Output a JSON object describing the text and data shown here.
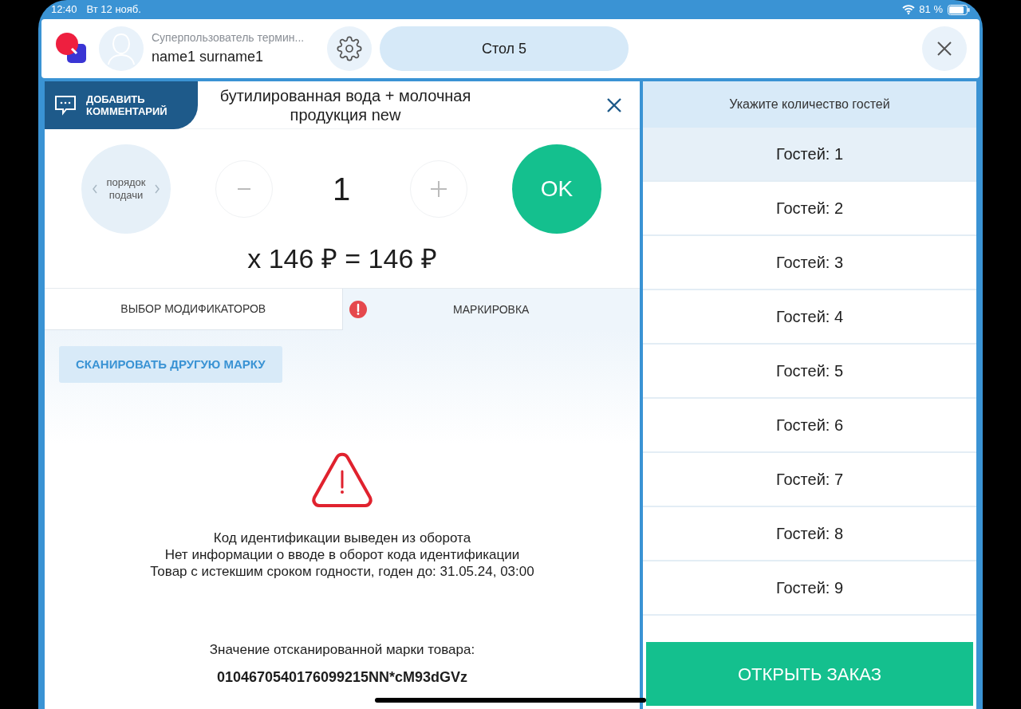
{
  "status_bar": {
    "time": "12:40",
    "date": "Вт 12 нояб.",
    "battery": "81 %"
  },
  "header": {
    "user_role": "Суперпользователь термин...",
    "user_name": "name1 surname1",
    "table": "Стол 5"
  },
  "item": {
    "comment_button": "ДОБАВИТЬ КОММЕНТАРИЙ",
    "title": "бутилированная вода + молочная продукция new",
    "course": "порядок подачи",
    "quantity": "1",
    "ok": "OK",
    "price": "x 146 ₽ = 146 ₽"
  },
  "tabs": [
    {
      "label": "ВЫБОР МОДИФИКАТОРОВ",
      "selected": false,
      "alert": false
    },
    {
      "label": "МАРКИРОВКА",
      "selected": true,
      "alert": true
    }
  ],
  "marking": {
    "scan_button": "СКАНИРОВАТЬ ДРУГУЮ МАРКУ",
    "errors": [
      "Код идентификации выведен из оборота",
      "Нет информации о вводе в оборот кода идентификации",
      "Товар с истекшим сроком годности, годен до: 31.05.24, 03:00"
    ],
    "scanned_label": "Значение отсканированной марки товара:",
    "scanned_value": "0104670540176099215NN*cM93dGVz"
  },
  "guests": {
    "title": "Укажите количество гостей",
    "options": [
      {
        "label": "Гостей: 1",
        "selected": true
      },
      {
        "label": "Гостей: 2",
        "selected": false
      },
      {
        "label": "Гостей: 3",
        "selected": false
      },
      {
        "label": "Гостей: 4",
        "selected": false
      },
      {
        "label": "Гостей: 5",
        "selected": false
      },
      {
        "label": "Гостей: 6",
        "selected": false
      },
      {
        "label": "Гостей: 7",
        "selected": false
      },
      {
        "label": "Гостей: 8",
        "selected": false
      },
      {
        "label": "Гостей: 9",
        "selected": false
      }
    ],
    "open_button": "ОТКРЫТЬ ЗАКАЗ"
  }
}
